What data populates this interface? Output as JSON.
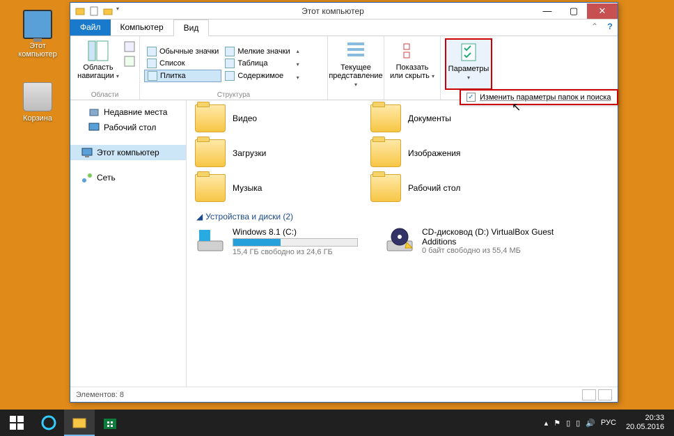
{
  "desktop": {
    "this_pc": "Этот компьютер",
    "recycle": "Корзина"
  },
  "window": {
    "title": "Этот компьютер",
    "tabs": {
      "file": "Файл",
      "computer": "Компьютер",
      "view": "Вид"
    },
    "ribbon": {
      "nav_pane": "Область навигации",
      "group_panes": "Области",
      "views": {
        "normal": "Обычные значки",
        "small": "Мелкие значки",
        "list": "Список",
        "table": "Таблица",
        "tiles": "Плитка",
        "content": "Содержимое"
      },
      "group_layout": "Структура",
      "current_view": "Текущее представление",
      "show_hide": "Показать или скрыть",
      "options": "Параметры"
    },
    "dropdown": {
      "change_options": "Изменить параметры папок и поиска"
    },
    "nav": {
      "recent": "Недавние места",
      "desktop": "Рабочий стол",
      "this_pc": "Этот компьютер",
      "network": "Сеть"
    },
    "folders": {
      "video": "Видео",
      "documents": "Документы",
      "downloads": "Загрузки",
      "pictures": "Изображения",
      "music": "Музыка",
      "desktop": "Рабочий стол"
    },
    "section_drives": "Устройства и диски (2)",
    "drives": {
      "c": {
        "name": "Windows 8.1 (C:)",
        "info": "15,4 ГБ свободно из 24,6 ГБ"
      },
      "d": {
        "name": "CD-дисковод (D:) VirtualBox Guest Additions",
        "info": "0 байт свободно из 55,4 МБ"
      }
    },
    "status": "Элементов: 8"
  },
  "taskbar": {
    "lang": "РУС",
    "time": "20:33",
    "date": "20.05.2016"
  }
}
